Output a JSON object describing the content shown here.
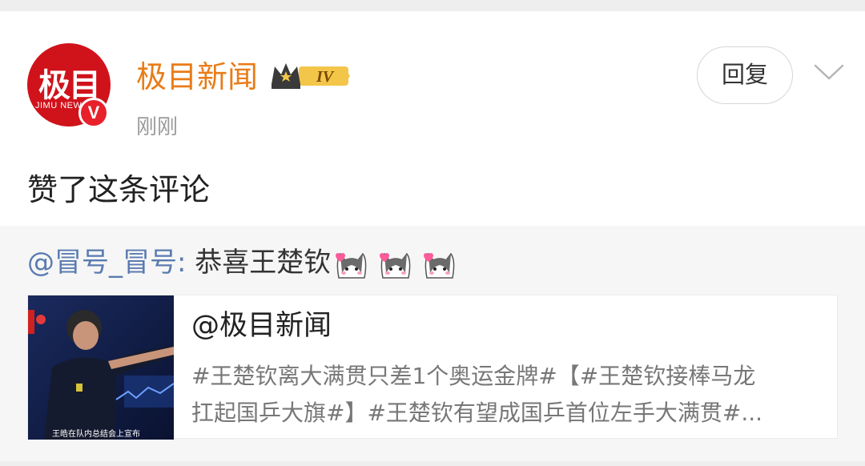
{
  "post": {
    "avatar_text": "极目",
    "avatar_subtext": "JIMU NEWS",
    "verified_badge": "V",
    "username": "极目新闻",
    "level_badge": "IV",
    "timestamp": "刚刚",
    "reply_label": "回复",
    "action_text": "赞了这条评论"
  },
  "quote": {
    "mention": "@冒号_冒号",
    "separator": ": ",
    "comment_text": "恭喜王楚钦",
    "emoji_names": [
      "cat-love-icon",
      "cat-love-icon",
      "cat-love-icon"
    ]
  },
  "link_card": {
    "title": "@极目新闻",
    "desc_line1": "#王楚钦离大满贯只差1个奥运金牌#【#王楚钦接棒马龙",
    "desc_line2": "扛起国乒大旗#】#王楚钦有望成国乒首位左手大满贯#...",
    "thumb_caption": "王皓在队内总结会上宣布"
  },
  "colors": {
    "username": "#e97c18",
    "mention": "#5a7bb0",
    "brand_red": "#d0121b"
  }
}
